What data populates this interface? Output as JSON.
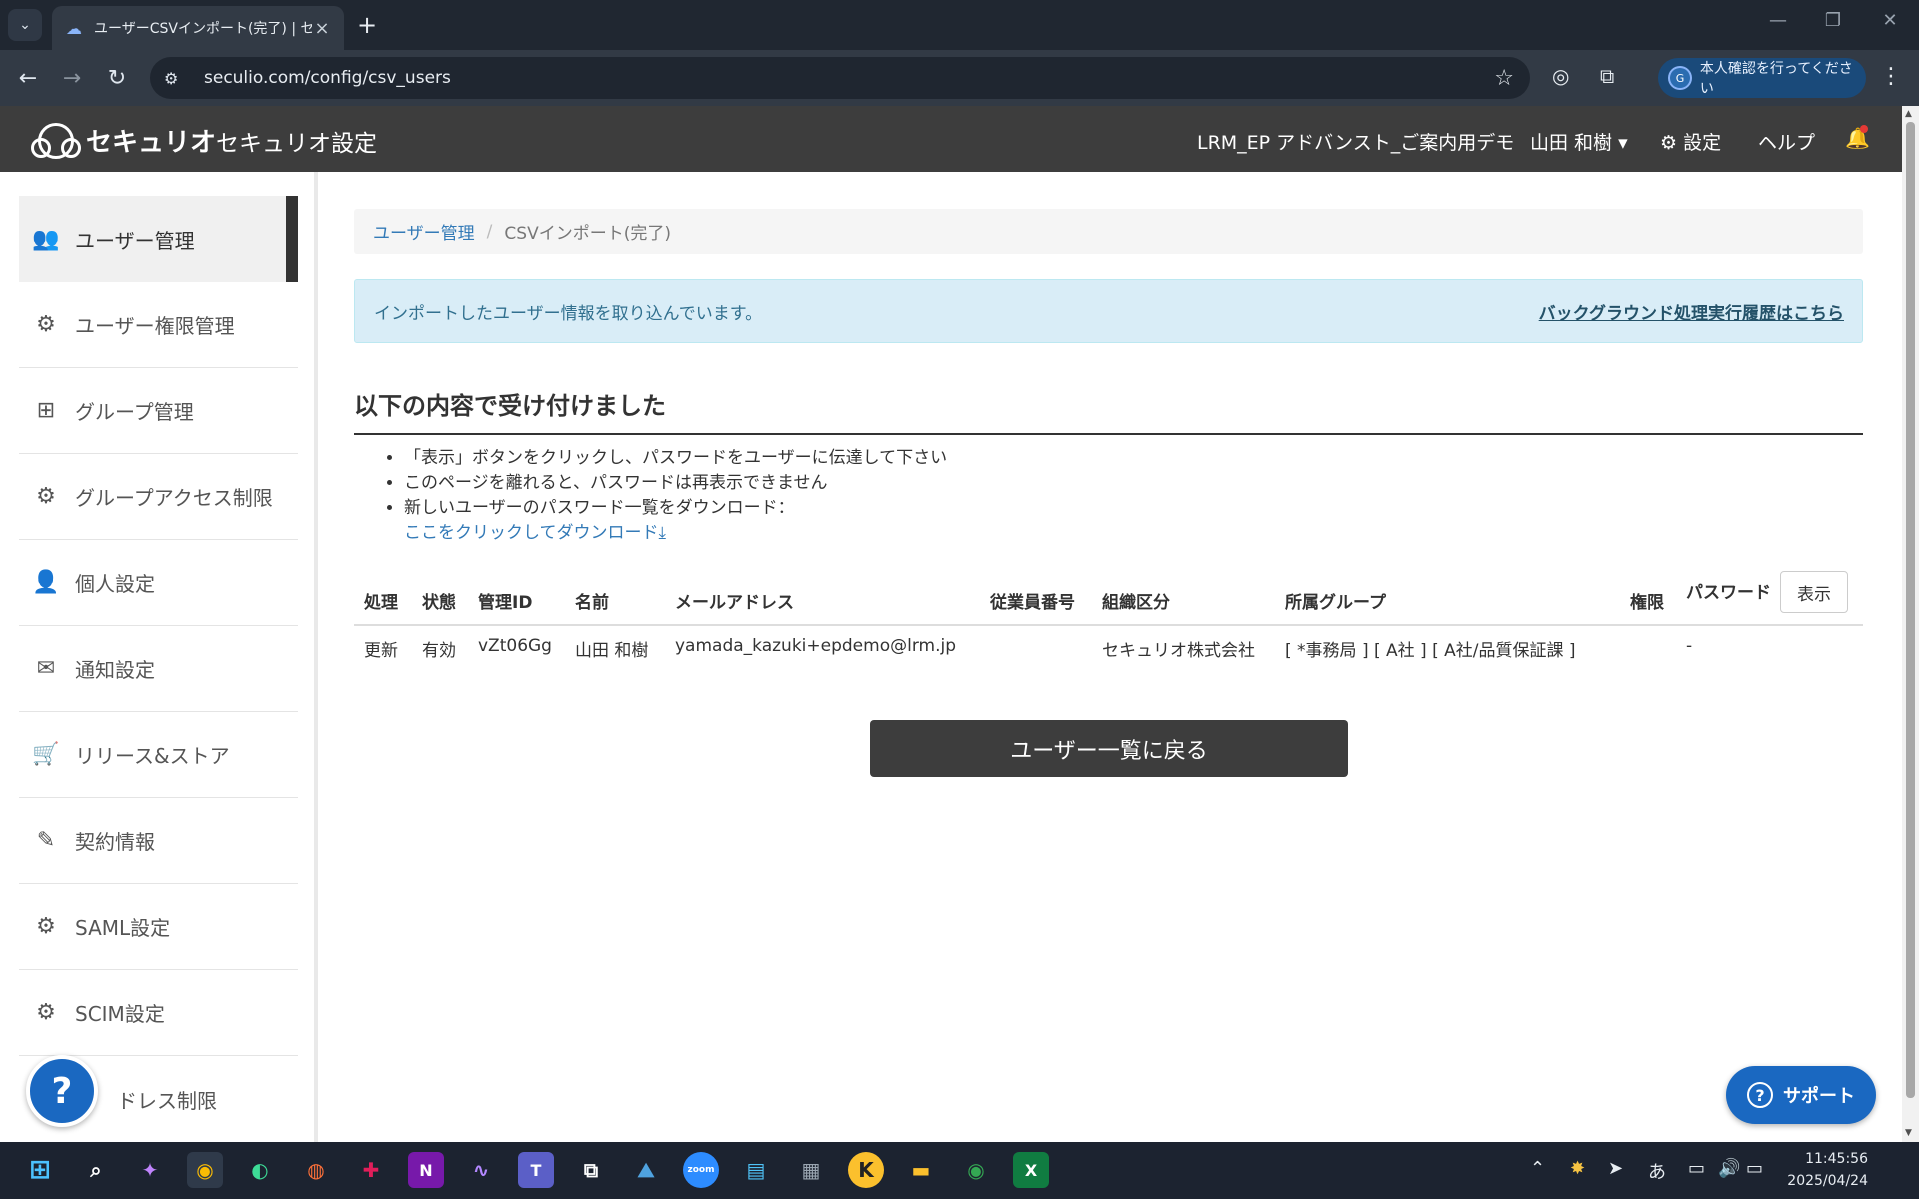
{
  "browser": {
    "tab_title": "ユーザーCSVインポート(完了) | セキュ",
    "url": "seculio.com/config/csv_users",
    "profile_label": "本人確認を行ってください",
    "profile_initial": "G"
  },
  "header": {
    "logo_text": "セキュリオ",
    "app_title": "セキュリオ設定",
    "org_name": "LRM_EP アドバンスト_ご案内用デモ",
    "user_name": "山田 和樹 ▾",
    "settings_label": "設定",
    "help_label": "ヘルプ"
  },
  "sidebar": {
    "items": [
      {
        "label": "ユーザー管理",
        "icon": "users-icon"
      },
      {
        "label": "ユーザー権限管理",
        "icon": "gear-icon"
      },
      {
        "label": "グループ管理",
        "icon": "sitemap-icon"
      },
      {
        "label": "グループアクセス制限",
        "icon": "gear-icon"
      },
      {
        "label": "個人設定",
        "icon": "user-icon"
      },
      {
        "label": "通知設定",
        "icon": "envelope-icon"
      },
      {
        "label": "リリース&ストア",
        "icon": "cart-icon"
      },
      {
        "label": "契約情報",
        "icon": "contract-icon"
      },
      {
        "label": "SAML設定",
        "icon": "gears-icon"
      },
      {
        "label": "SCIM設定",
        "icon": "users-gear-icon"
      },
      {
        "label": "ドレス制限",
        "icon": "lock-icon"
      }
    ]
  },
  "breadcrumb": {
    "parent": "ユーザー管理",
    "separator": "/",
    "current": "CSVインポート(完了)"
  },
  "alert": {
    "message": "インポートしたユーザー情報を取り込んでいます。",
    "link": "バックグラウンド処理実行履歴はこちら"
  },
  "section": {
    "title": "以下の内容で受け付けました",
    "notes": [
      "「表示」ボタンをクリックし、パスワードをユーザーに伝達して下さい",
      "このページを離れると、パスワードは再表示できません",
      "新しいユーザーのパスワード一覧をダウンロード："
    ],
    "download_link": "ここをクリックしてダウンロード"
  },
  "table": {
    "headers": [
      "処理",
      "状態",
      "管理ID",
      "名前",
      "メールアドレス",
      "従業員番号",
      "組織区分",
      "所属グループ",
      "権限",
      "パスワード"
    ],
    "show_button": "表示",
    "rows": [
      {
        "action": "更新",
        "status": "有効",
        "admin_id": "vZt06Gg",
        "name": "山田 和樹",
        "email": "yamada_kazuki+epdemo@lrm.jp",
        "employee_no": "",
        "org": "セキュリオ株式会社",
        "groups": "[ *事務局 ] [ A社 ] [ A社/品質保証課 ]",
        "role": "",
        "password": "-"
      }
    ]
  },
  "back_button": "ユーザー一覧に戻る",
  "support_button": "サポート",
  "taskbar": {
    "time": "11:45:56",
    "date": "2025/04/24",
    "ime": "あ"
  },
  "colors": {
    "header_bg": "#3d3d3d",
    "link": "#337ab7",
    "alert_bg": "#d9edf7",
    "support": "#1a68c1"
  }
}
